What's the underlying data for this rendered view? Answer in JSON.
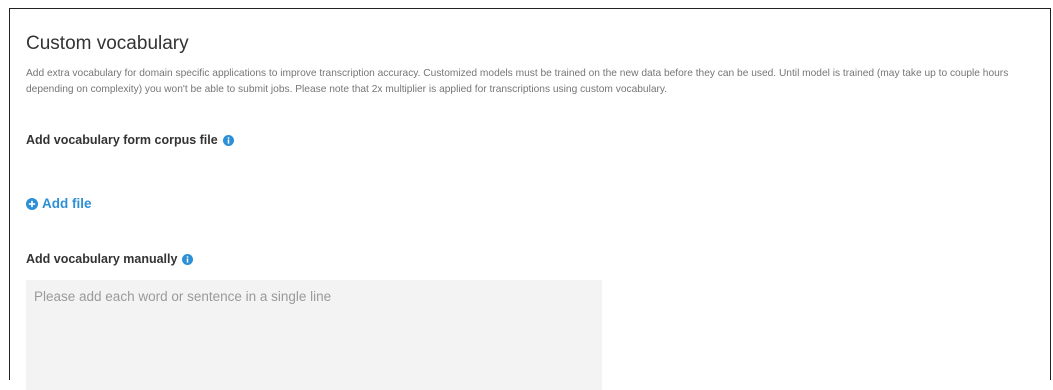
{
  "panel": {
    "title": "Custom vocabulary",
    "description": "Add extra vocabulary for domain specific applications to improve transcription accuracy. Customized models must be trained on the new data before they can be used. Until model is trained (may take up to couple hours depending on complexity) you won't be able to submit jobs. Please note that 2x multiplier is applied for transcriptions using custom vocabulary."
  },
  "corpus_section": {
    "label": "Add vocabulary form corpus file",
    "info_icon": "info-circle-icon",
    "add_file_label": "Add file",
    "add_file_icon": "plus-circle-icon"
  },
  "manual_section": {
    "label": "Add vocabulary manually",
    "info_icon": "info-circle-icon",
    "textarea_value": "",
    "textarea_placeholder": "Please add each word or sentence in a single line"
  },
  "colors": {
    "accent": "#2d8fd5",
    "text": "#333333",
    "muted_text": "#767676",
    "textarea_bg": "#f3f3f3"
  }
}
